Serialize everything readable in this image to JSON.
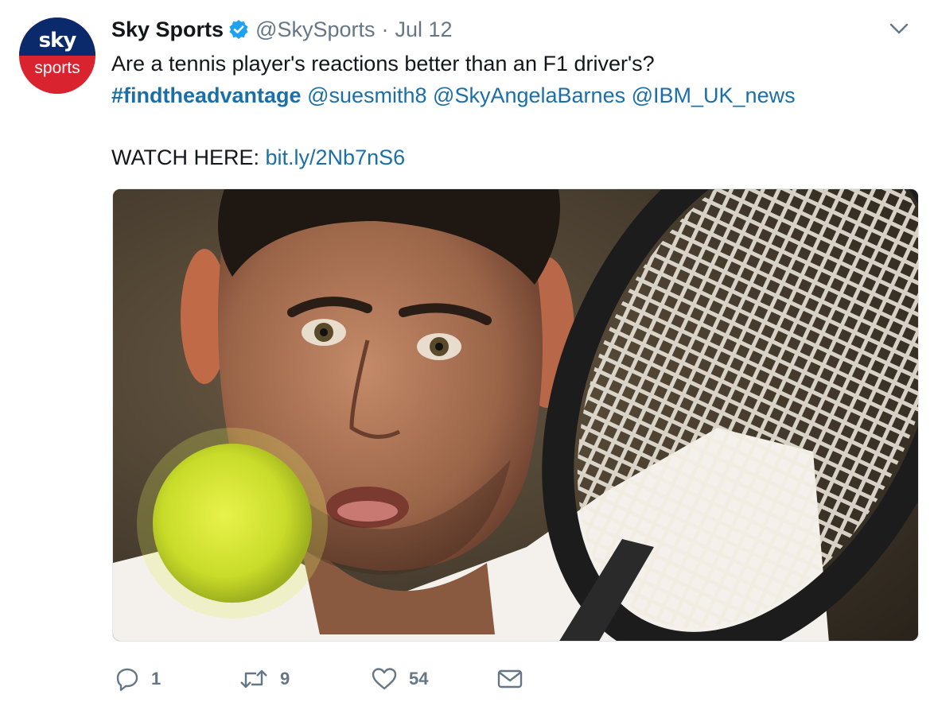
{
  "author": {
    "avatar_top_text": "sky",
    "avatar_bottom_text": "sports",
    "display_name": "Sky Sports",
    "handle": "@SkySports",
    "separator": "·",
    "date": "Jul 12"
  },
  "tweet": {
    "line1": "Are a tennis player's reactions better than an F1 driver's?",
    "hashtag": "#findtheadvantage",
    "mentions": [
      "@suesmith8",
      "@SkyAngelaBarnes",
      "@IBM_UK_news"
    ],
    "watch_label": "WATCH HERE:",
    "link": "bit.ly/2Nb7nS6"
  },
  "actions": {
    "replies": "1",
    "retweets": "9",
    "likes": "54"
  },
  "icons": {
    "verified": "verified-badge-icon",
    "caret": "chevron-down-icon",
    "reply": "reply-icon",
    "retweet": "retweet-icon",
    "like": "heart-icon",
    "dm": "envelope-icon"
  },
  "colors": {
    "link": "#1b6fa8",
    "muted": "#657786",
    "verified": "#1da1f2",
    "avatar_blue": "#0a2a6b",
    "avatar_red": "#d9232e"
  }
}
